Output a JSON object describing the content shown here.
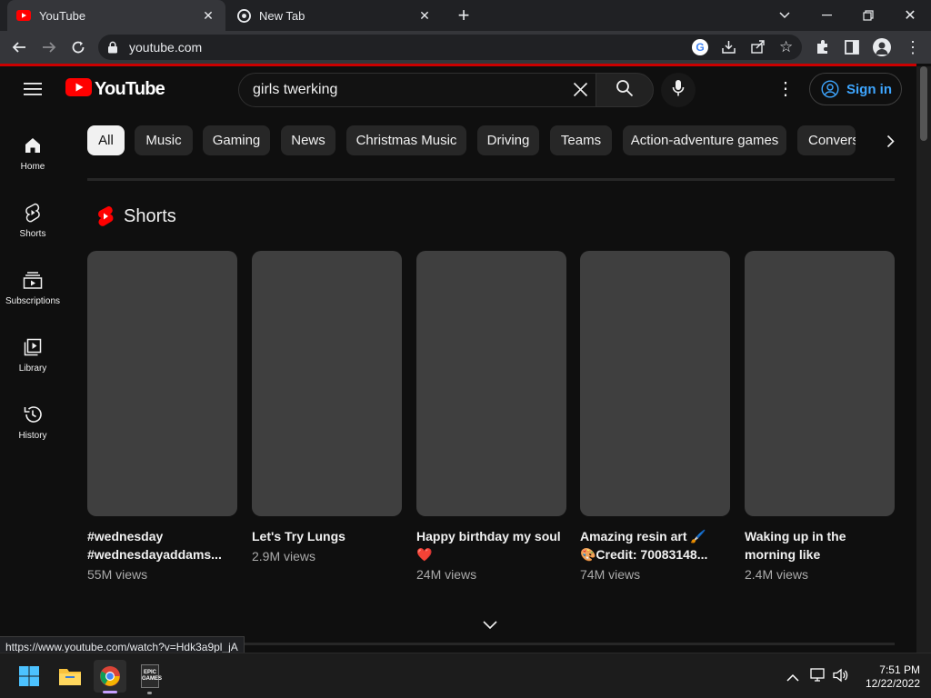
{
  "browser": {
    "tabs": [
      {
        "title": "YouTube"
      },
      {
        "title": "New Tab"
      }
    ],
    "url": "youtube.com",
    "status_link": "https://www.youtube.com/watch?v=Hdk3a9pl_jA"
  },
  "youtube": {
    "logo_text": "YouTube",
    "search_value": "girls twerking",
    "sign_in_label": "Sign in",
    "sidebar": [
      {
        "label": "Home"
      },
      {
        "label": "Shorts"
      },
      {
        "label": "Subscriptions"
      },
      {
        "label": "Library"
      },
      {
        "label": "History"
      }
    ],
    "chips": [
      "All",
      "Music",
      "Gaming",
      "News",
      "Christmas Music",
      "Driving",
      "Teams",
      "Action-adventure games",
      "Convers"
    ],
    "shorts_heading": "Shorts",
    "shorts": [
      {
        "title": "#wednesday #wednesdayaddams...",
        "views": "55M views"
      },
      {
        "title": "Let's Try Lungs",
        "views": "2.9M views"
      },
      {
        "title": "Happy birthday my soul ❤️",
        "views": "24M views"
      },
      {
        "title": "Amazing resin art 🖌️ 🎨Credit: 70083148...",
        "views": "74M views"
      },
      {
        "title": "Waking up in the morning like",
        "views": "2.4M views"
      }
    ]
  },
  "taskbar": {
    "time": "7:51 PM",
    "date": "12/22/2022",
    "epic_label": "EPIC GAMES"
  },
  "colors": {
    "youtube_red": "#ff0000",
    "sign_in_blue": "#3ea6ff",
    "background": "#0f0f0f"
  }
}
